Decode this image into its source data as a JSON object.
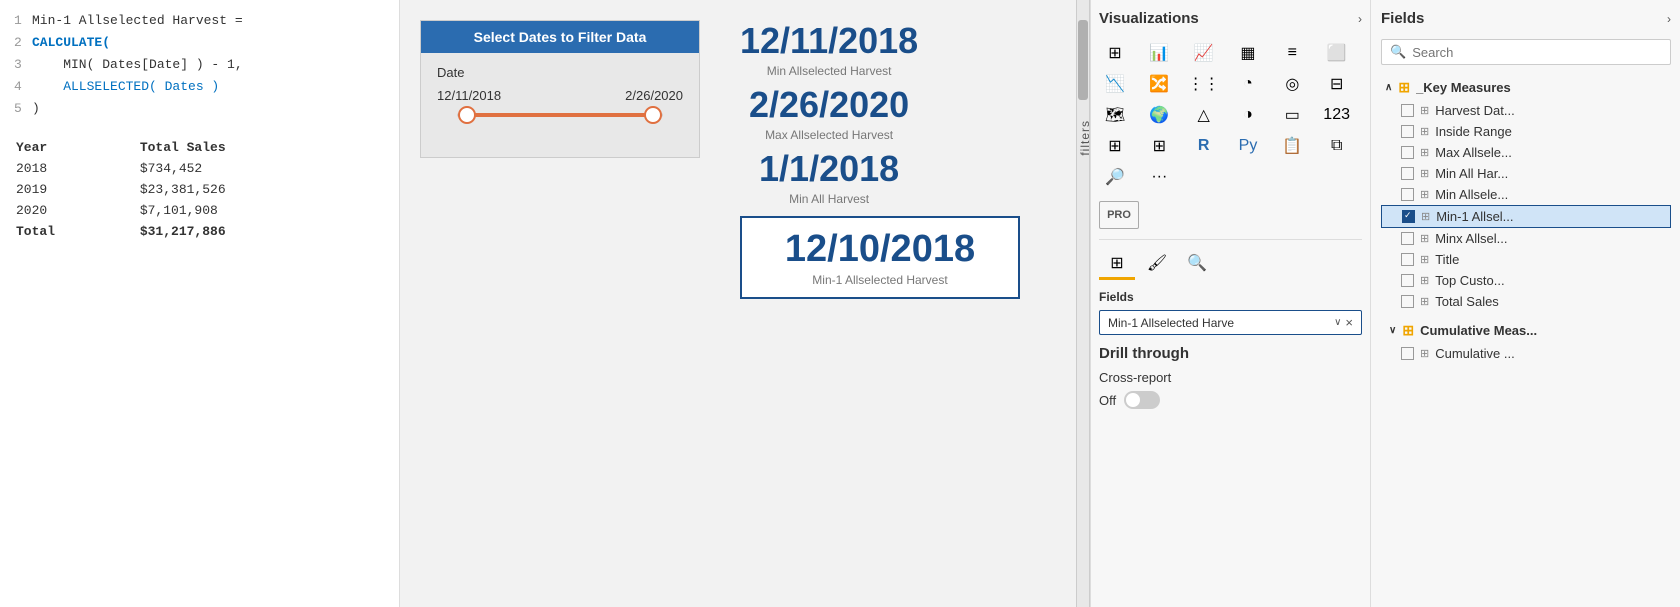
{
  "code": {
    "lines": [
      {
        "num": "1",
        "text": "Min-1 Allselected Harvest =",
        "type": "comment"
      },
      {
        "num": "2",
        "text": "CALCULATE(",
        "type": "keyword"
      },
      {
        "num": "3",
        "text": "    MIN( Dates[Date] ) - 1,",
        "type": "normal"
      },
      {
        "num": "4",
        "text": "    ALLSELECTED( Dates )",
        "type": "func"
      },
      {
        "num": "5",
        "text": ")",
        "type": "normal"
      }
    ]
  },
  "table": {
    "headers": [
      "Year",
      "Total Sales"
    ],
    "rows": [
      {
        "year": "2018",
        "sales": "$734,452"
      },
      {
        "year": "2019",
        "sales": "$23,381,526"
      },
      {
        "year": "2020",
        "sales": "$7,101,908"
      }
    ],
    "total_label": "Total",
    "total_value": "$31,217,886"
  },
  "date_slicer": {
    "title": "Select Dates to Filter Data",
    "label": "Date",
    "start": "12/11/2018",
    "end": "2/26/2020"
  },
  "kpi": {
    "top": {
      "value": "12/11/2018",
      "label": "Min Allselected Harvest"
    },
    "middle": {
      "value": "2/26/2020",
      "label": "Max Allselected Harvest"
    },
    "third": {
      "value": "1/1/2018",
      "label": "Min All Harvest"
    },
    "boxed": {
      "value": "12/10/2018",
      "label": "Min-1 Allselected Harvest"
    }
  },
  "visualizations": {
    "panel_title": "Visualizations",
    "chevron": "›",
    "tabs": {
      "fields_label": "Fields",
      "active": "fields"
    },
    "fields_section": "Fields",
    "field_chip": "Min-1 Allselected Harve",
    "drill_through": {
      "title": "Drill through",
      "cross_report_label": "Cross-report",
      "toggle_label": "Off"
    }
  },
  "fields_panel": {
    "title": "Fields",
    "chevron": "›",
    "search_placeholder": "Search",
    "groups": [
      {
        "name": "_Key Measures",
        "icon": "⊞",
        "chevron": "∧",
        "items": [
          {
            "label": "Harvest Dat...",
            "checked": false
          },
          {
            "label": "Inside Range",
            "checked": false
          },
          {
            "label": "Max Allsele...",
            "checked": false
          },
          {
            "label": "Min All Har...",
            "checked": false
          },
          {
            "label": "Min Allsele...",
            "checked": false
          },
          {
            "label": "Min-1 Allsel...",
            "checked": true,
            "selected": true
          },
          {
            "label": "Minx Allsel...",
            "checked": false
          },
          {
            "label": "Title",
            "checked": false
          },
          {
            "label": "Top Custo...",
            "checked": false
          },
          {
            "label": "Total Sales",
            "checked": false
          }
        ]
      },
      {
        "name": "Cumulative Meas...",
        "icon": "⊞",
        "chevron": "∨",
        "items": [
          {
            "label": "Cumulative ...",
            "checked": false
          }
        ]
      }
    ]
  }
}
